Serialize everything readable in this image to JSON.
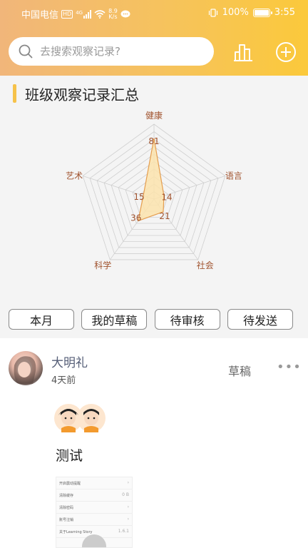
{
  "status_bar": {
    "carrier": "中国电信",
    "hd": "HD",
    "signal_tag": "4G",
    "speed_value": "8.9",
    "speed_unit": "K/s",
    "battery": "100%",
    "time": "3:55"
  },
  "search": {
    "placeholder": "去搜索观察记录?"
  },
  "header_icons": [
    "bar-chart-icon",
    "add-circle-icon"
  ],
  "section": {
    "title": "班级观察记录汇总"
  },
  "chart_data": {
    "type": "radar",
    "categories": [
      "健康",
      "语言",
      "社会",
      "科学",
      "艺术"
    ],
    "values": [
      81,
      14,
      21,
      36,
      15
    ],
    "range": [
      0,
      100
    ],
    "colors": {
      "fill": "#fbe3ad",
      "stroke": "#e59e4f",
      "grid": "#cfcfcf",
      "label": "#a0522d"
    }
  },
  "filters": [
    "本月",
    "我的草稿",
    "待审核",
    "待发送"
  ],
  "record": {
    "user_name": "大明礼",
    "time_ago": "4天前",
    "status": "草稿",
    "more": "•••",
    "content": "测试",
    "preview_rows": [
      {
        "label": "开启震动提醒",
        "value": ""
      },
      {
        "label": "清除缓存",
        "value": "0 B"
      },
      {
        "label": "清除密码",
        "value": ""
      },
      {
        "label": "账号注销",
        "value": ""
      },
      {
        "label": "关于Learning Story",
        "value": "1.6.1"
      }
    ]
  },
  "colors": {
    "header_start": "#f1b67a",
    "header_end": "#fbc93b",
    "accent": "#f6c24a"
  }
}
